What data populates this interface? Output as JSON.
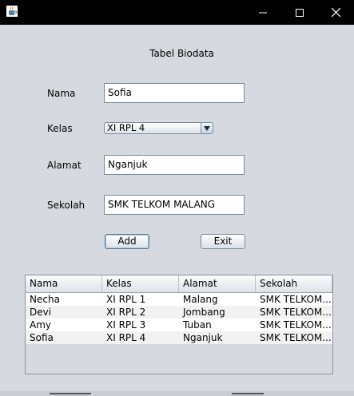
{
  "window": {
    "icon": "java-cup-icon"
  },
  "form": {
    "title": "Tabel Biodata",
    "nama_label": "Nama",
    "nama_value": "Sofia",
    "kelas_label": "Kelas",
    "kelas_value": "XI RPL 4",
    "alamat_label": "Alamat",
    "alamat_value": "Nganjuk",
    "sekolah_label": "Sekolah",
    "sekolah_value": "SMK TELKOM MALANG",
    "add_label": "Add",
    "exit_label": "Exit"
  },
  "table": {
    "headers": [
      "Nama",
      "Kelas",
      "Alamat",
      "Sekolah"
    ],
    "rows": [
      [
        "Necha",
        "XI RPL 1",
        "Malang",
        "SMK TELKOM..."
      ],
      [
        "Devi",
        "XI RPL 2",
        "Jombang",
        "SMK TELKOM..."
      ],
      [
        "Amy",
        "XI RPL 3",
        "Tuban",
        "SMK TELKOM..."
      ],
      [
        "Sofia",
        "XI RPL 4",
        "Nganjuk",
        "SMK TELKOM..."
      ]
    ]
  },
  "colors": {
    "titlebar": "#000000",
    "window_bg": "#d6d9df",
    "field_border": "#7a8a99"
  }
}
